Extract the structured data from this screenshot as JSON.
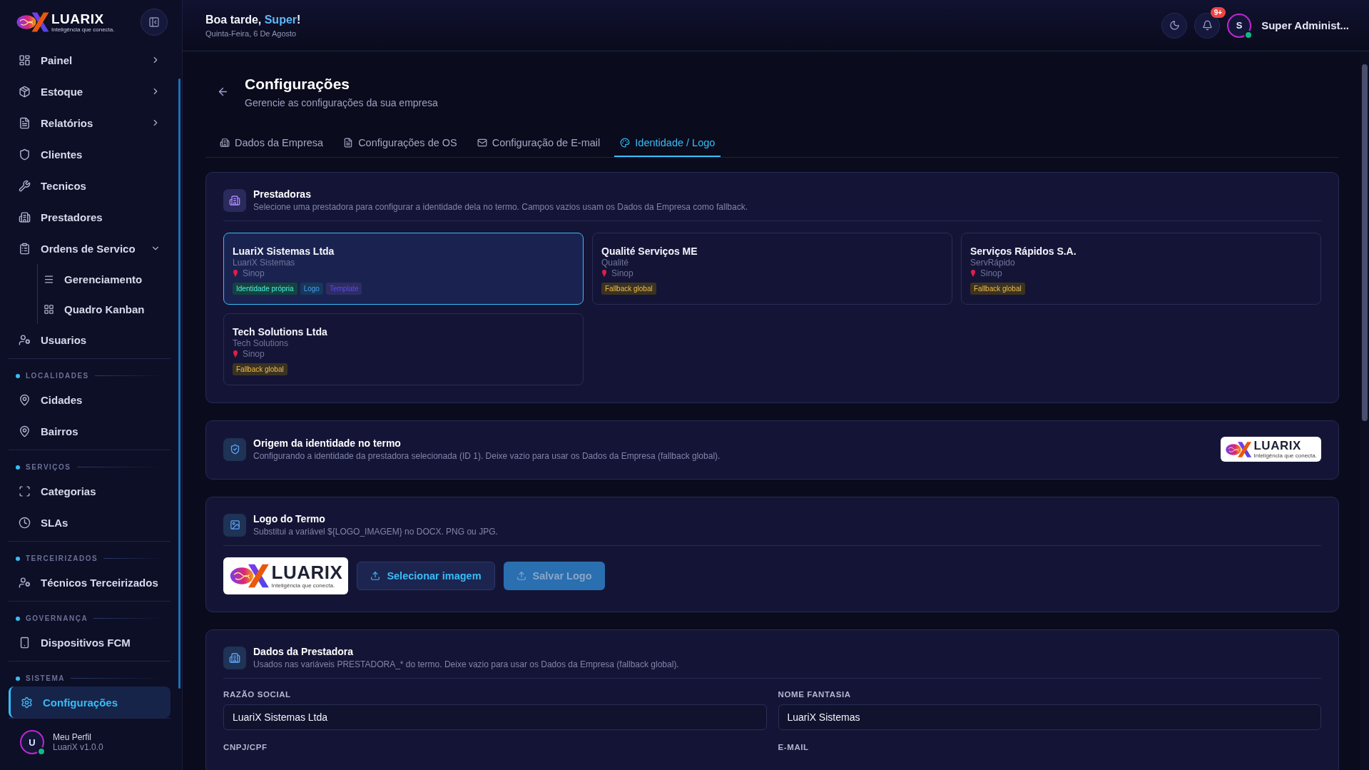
{
  "sidebar": {
    "logo": {
      "wordmark": "LUARIX",
      "tagline": "Inteligência que conecta."
    },
    "nav": [
      {
        "kind": "item",
        "label": "Painel",
        "expanded": false,
        "selected": false
      },
      {
        "kind": "item",
        "label": "Estoque",
        "expanded": false,
        "selected": false
      },
      {
        "kind": "item",
        "label": "Relatórios",
        "expanded": false,
        "selected": false
      },
      {
        "kind": "item",
        "label": "Clientes",
        "selected": false
      },
      {
        "kind": "item",
        "label": "Tecnicos",
        "selected": false
      },
      {
        "kind": "item",
        "label": "Prestadores",
        "selected": false
      },
      {
        "kind": "item",
        "label": "Ordens de Servico",
        "expanded": true,
        "selected": false,
        "children": [
          {
            "label": "Gerenciamento",
            "selected": false
          },
          {
            "label": "Quadro Kanban",
            "selected": false
          }
        ]
      },
      {
        "kind": "item",
        "label": "Usuarios",
        "selected": false
      },
      {
        "kind": "section",
        "label": "LOCALIDADES",
        "items": [
          {
            "label": "Cidades",
            "selected": false
          },
          {
            "label": "Bairros",
            "selected": false
          }
        ]
      },
      {
        "kind": "section",
        "label": "SERVIÇOS",
        "items": [
          {
            "label": "Categorias",
            "selected": false
          },
          {
            "label": "SLAs",
            "selected": false
          }
        ]
      },
      {
        "kind": "section",
        "label": "TERCEIRIZADOS",
        "items": [
          {
            "label": "Técnicos Terceirizados",
            "selected": false
          }
        ]
      },
      {
        "kind": "section",
        "label": "GOVERNANÇA",
        "items": [
          {
            "label": "Dispositivos FCM",
            "selected": false
          }
        ]
      },
      {
        "kind": "section",
        "label": "SISTEMA",
        "items": [
          {
            "label": "Configurações",
            "selected": true
          }
        ]
      }
    ],
    "profile": {
      "initial": "U",
      "name": "Meu Perfil",
      "version": "LuariX v1.0.0",
      "online": true
    }
  },
  "header": {
    "greeting": {
      "prefix": "Boa tarde, ",
      "name": "Super",
      "suffix": "!"
    },
    "date": "Quinta-Feira, 6 De Agosto",
    "notifications": "9+",
    "user": {
      "initial": "S",
      "name": "Super Administ...",
      "online": true
    }
  },
  "page": {
    "title": "Configurações",
    "subtitle": "Gerencie as configurações da sua empresa",
    "tabs": [
      {
        "label": "Dados da Empresa",
        "selected": false
      },
      {
        "label": "Configurações de OS",
        "selected": false
      },
      {
        "label": "Configuração de E-mail",
        "selected": false
      },
      {
        "label": "Identidade / Logo",
        "selected": true
      }
    ]
  },
  "prestadoras": {
    "title": "Prestadoras",
    "description": "Selecione uma prestadora para configurar a identidade dela no termo. Campos vazios usam os Dados da Empresa como fallback.",
    "items": [
      {
        "name": "LuariX Sistemas Ltda",
        "fantasy": "LuariX Sistemas",
        "city": "Sinop",
        "selected": true,
        "tags": [
          {
            "label": "Identidade própria",
            "color": "#15433f"
          },
          {
            "label": "Logo",
            "color": "#16385a"
          },
          {
            "label": "Template",
            "color": "#2f2c63"
          }
        ]
      },
      {
        "name": "Qualité Serviços ME",
        "fantasy": "Qualité",
        "city": "Sinop",
        "selected": false,
        "tags": [
          {
            "label": "Fallback global",
            "color": "#3b3322"
          }
        ]
      },
      {
        "name": "Serviços Rápidos S.A.",
        "fantasy": "ServRápido",
        "city": "Sinop",
        "selected": false,
        "tags": [
          {
            "label": "Fallback global",
            "color": "#3b3322"
          }
        ]
      },
      {
        "name": "Tech Solutions Ltda",
        "fantasy": "Tech Solutions",
        "city": "Sinop",
        "selected": false,
        "tags": [
          {
            "label": "Fallback global",
            "color": "#3b3322"
          }
        ]
      }
    ]
  },
  "origem": {
    "title": "Origem da identidade no termo",
    "description": "Configurando a identidade da prestadora selecionada (ID 1). Deixe vazio para usar os Dados da Empresa (fallback global).",
    "logo": {
      "wordmark": "LUARIX",
      "tagline": "Inteligência que conecta."
    }
  },
  "logo_termo": {
    "title": "Logo do Termo",
    "description": "Substitui a variável ${LOGO_IMAGEM} no DOCX. PNG ou JPG.",
    "logo": {
      "wordmark": "LUARIX",
      "tagline": "Inteligência que conecta."
    },
    "buttons": [
      {
        "label": "Selecionar imagem",
        "kind": "outline",
        "disabled": false
      },
      {
        "label": "Salvar Logo",
        "kind": "primary",
        "disabled": true
      }
    ]
  },
  "dados_prestadora": {
    "title": "Dados da Prestadora",
    "description": "Usados nas variáveis PRESTADORA_* do termo. Deixe vazio para usar os Dados da Empresa (fallback global).",
    "fields": [
      {
        "label": "RAZÃO SOCIAL",
        "value": "LuariX Sistemas Ltda"
      },
      {
        "label": "NOME FANTASIA",
        "value": "LuariX Sistemas"
      },
      {
        "label": "CNPJ/CPF"
      },
      {
        "label": "E-MAIL"
      }
    ]
  }
}
